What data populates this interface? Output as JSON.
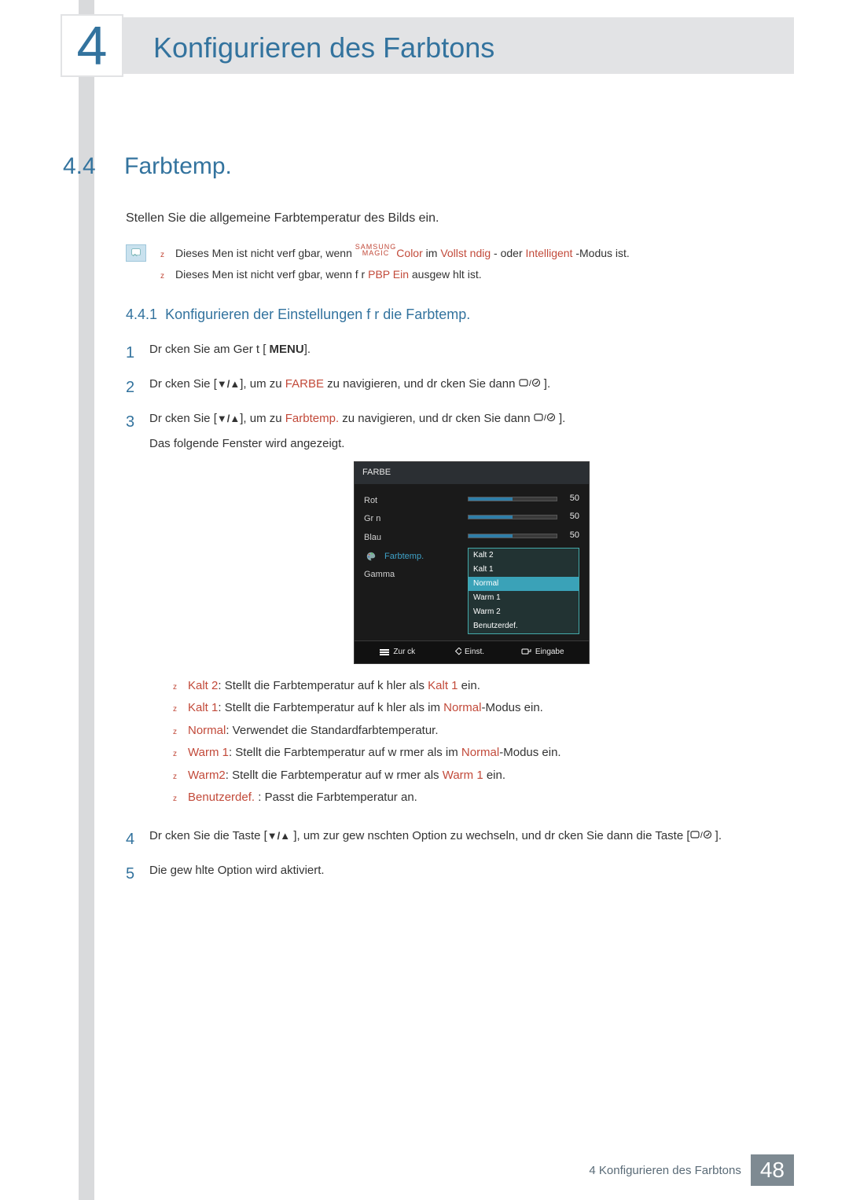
{
  "chapter": {
    "number": "4",
    "title": "Konfigurieren des Farbtons"
  },
  "section": {
    "number": "4.4",
    "title": "Farbtemp."
  },
  "intro": "Stellen Sie die allgemeine Farbtemperatur des Bilds ein.",
  "notes": {
    "n1": {
      "pre": "Dieses Men  ist nicht verf gbar, wenn ",
      "magic_top": "SAMSUNG",
      "magic_bot": "MAGIC",
      "color": "Color",
      "mid": " im ",
      "mode1": "Vollst ndig",
      "dash": " - oder ",
      "mode2": "Intelligent",
      "post": " -Modus ist."
    },
    "n2": {
      "pre": "Dieses Men  ist nicht verf gbar, wenn f r ",
      "pbp": "PBP",
      "ein": "Ein",
      "post": " ausgew hlt ist."
    }
  },
  "subsection": {
    "number": "4.4.1",
    "title": "Konfigurieren der Einstellungen f r die Farbtemp."
  },
  "steps": {
    "s1": {
      "num": "1",
      "pre": "Dr cken Sie am Ger t [ ",
      "menu": "MENU",
      "post": "]."
    },
    "s2": {
      "num": "2",
      "pre": "Dr cken Sie [",
      "arrows": "▼/▲",
      "mid": "], um zu ",
      "target": "FARBE",
      "mid2": " zu navigieren, und dr cken Sie dann ",
      "post": " ]."
    },
    "s3": {
      "num": "3",
      "pre": "Dr cken Sie [",
      "arrows": "▼/▲",
      "mid": "], um zu ",
      "target": "Farbtemp.",
      "mid2": "  zu navigieren, und dr cken Sie dann ",
      "post": " ].",
      "after": "Das folgende Fenster wird angezeigt."
    },
    "s4": {
      "num": "4",
      "pre": "Dr cken Sie die Taste [",
      "arrows": "▼/▲",
      "mid": " ], um zur gew nschten Option zu wechseln, und dr cken Sie dann die Taste [",
      "post": " ]."
    },
    "s5": {
      "num": "5",
      "text": "Die gew hlte Option wird aktiviert."
    }
  },
  "osd": {
    "title": "FARBE",
    "items": {
      "rot": "Rot",
      "grn": "Gr n",
      "blau": "Blau",
      "farbtemp": "Farbtemp.",
      "gamma": "Gamma"
    },
    "val": "50",
    "opts": {
      "k2": "Kalt 2",
      "k1": "Kalt 1",
      "nor": "Normal",
      "w1": "Warm 1",
      "w2": "Warm 2",
      "ben": "Benutzerdef."
    },
    "foot": {
      "back": "Zur ck",
      "adj": "Einst.",
      "enter": "Eingabe"
    }
  },
  "bulletList": {
    "b1": {
      "term": "Kalt 2",
      "text": ": Stellt die Farbtemperatur auf k hler als ",
      "ref": "Kalt 1",
      "post": " ein."
    },
    "b2": {
      "term": "Kalt 1",
      "text": ": Stellt die Farbtemperatur auf k hler als im ",
      "ref": "Normal",
      "post": "-Modus ein."
    },
    "b3": {
      "term": "Normal",
      "text": ": Verwendet die Standardfarbtemperatur."
    },
    "b4": {
      "term": "Warm 1",
      "text": ": Stellt die Farbtemperatur auf w rmer als im ",
      "ref": "Normal",
      "post": "-Modus ein."
    },
    "b5": {
      "term": "Warm2",
      "text": ": Stellt die Farbtemperatur auf w rmer als ",
      "ref": "Warm 1",
      "post": " ein."
    },
    "b6": {
      "term": "Benutzerdef.",
      "text": " : Passt die Farbtemperatur an."
    }
  },
  "footer": {
    "text": "4 Konfigurieren des Farbtons",
    "page": "48"
  }
}
